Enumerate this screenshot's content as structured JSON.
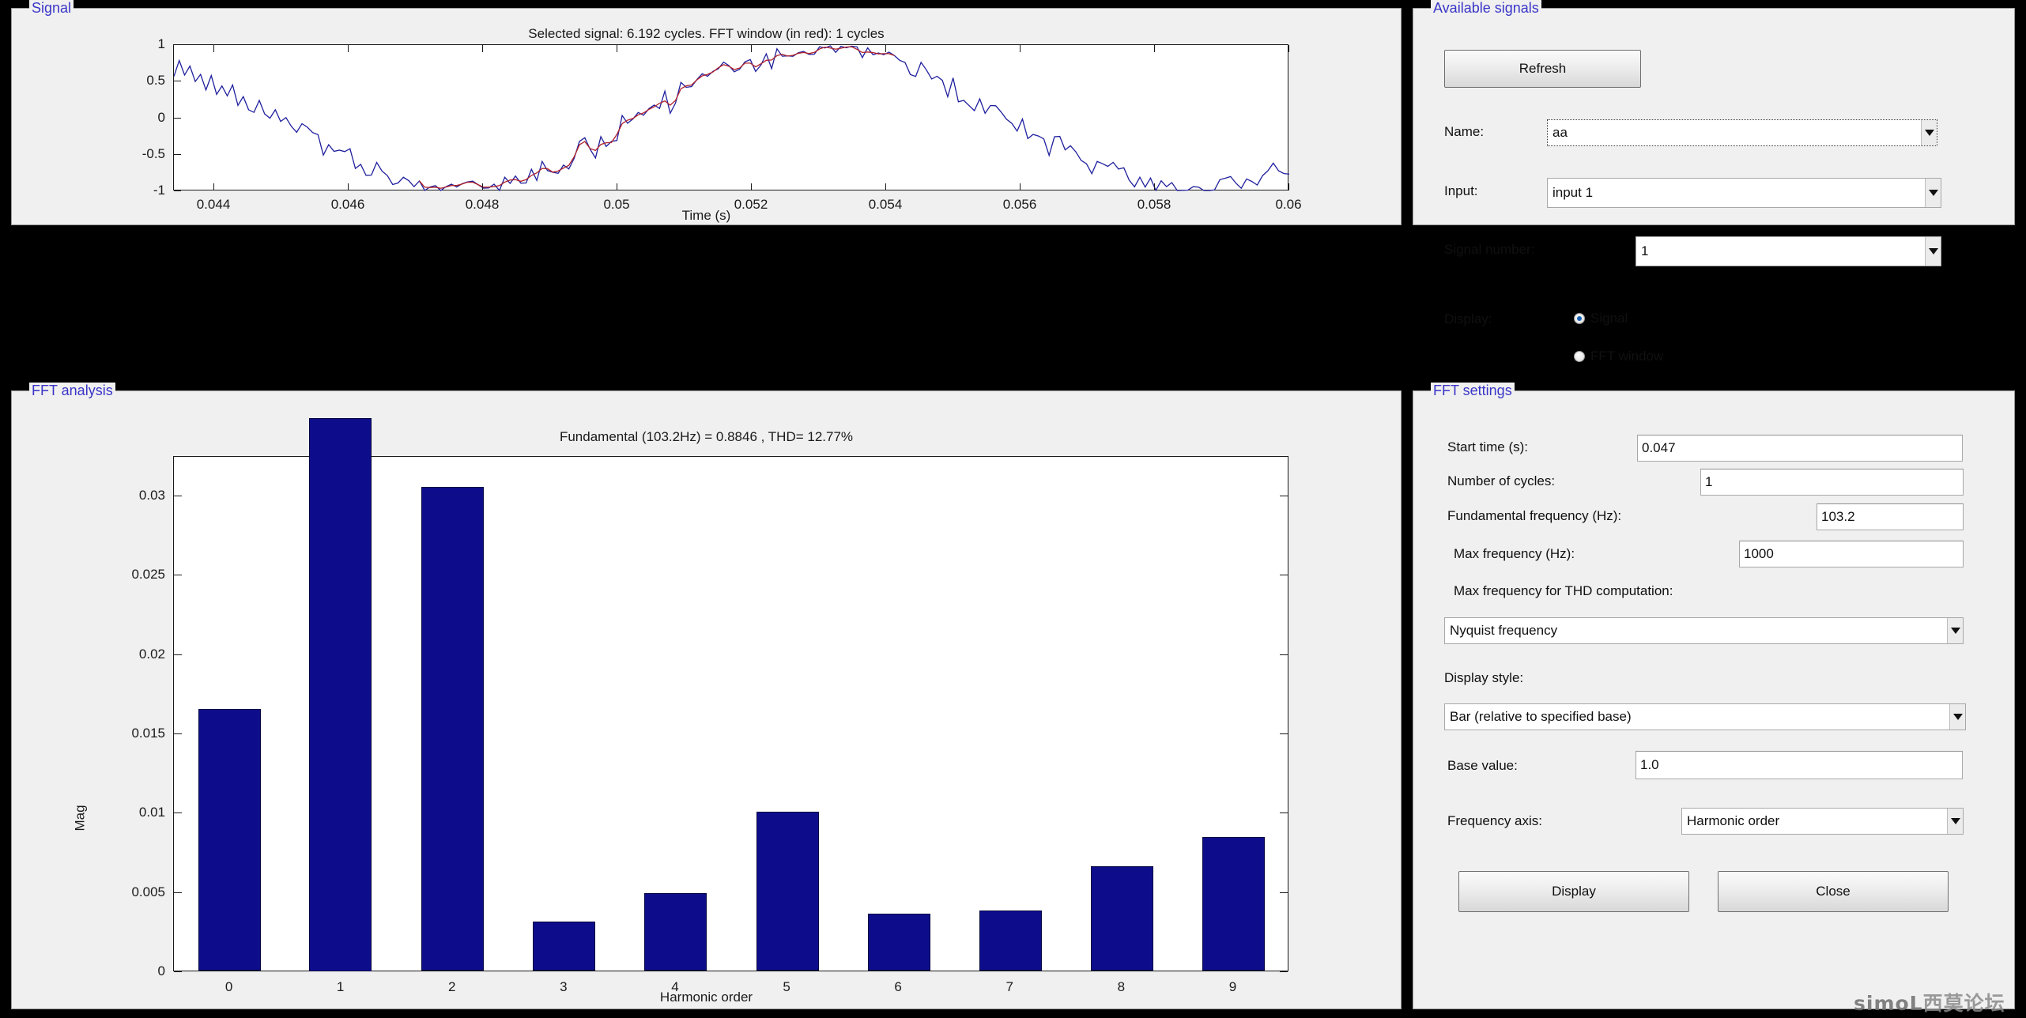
{
  "panels": {
    "signal": {
      "title": "Signal"
    },
    "fft_analysis": {
      "title": "FFT analysis"
    },
    "available_signals": {
      "title": "Available signals"
    },
    "fft_settings": {
      "title": "FFT settings"
    }
  },
  "signal_plot": {
    "title": "Selected signal: 6.192 cycles. FFT window (in red): 1 cycles",
    "xlabel": "Time (s)",
    "yticks": [
      "1",
      "0.5",
      "0",
      "-0.5",
      "-1"
    ],
    "xticks": [
      "0.044",
      "0.046",
      "0.048",
      "0.05",
      "0.052",
      "0.054",
      "0.056",
      "0.058",
      "0.06"
    ]
  },
  "fft_plot": {
    "title": "Fundamental (103.2Hz) = 0.8846 , THD= 12.77%",
    "xlabel": "Harmonic order",
    "ylabel": "Mag"
  },
  "available_signals": {
    "refresh_label": "Refresh",
    "name_label": "Name:",
    "name_value": "aa",
    "input_label": "Input:",
    "input_value": "input 1",
    "signal_number_label": "Signal number:",
    "signal_number_value": "1",
    "display_label": "Display:",
    "radio_signal": "Signal",
    "radio_fft_window": "FFT window",
    "display_selected": "Signal"
  },
  "fft_settings": {
    "start_time_label": "Start time (s):",
    "start_time_value": "0.047",
    "cycles_label": "Number of cycles:",
    "cycles_value": "1",
    "fundamental_label": "Fundamental frequency (Hz):",
    "fundamental_value": "103.2",
    "max_freq_label": "Max frequency (Hz):",
    "max_freq_value": "1000",
    "max_freq_thd_label": "Max frequency for THD computation:",
    "max_freq_thd_value": "Nyquist frequency",
    "display_style_label": "Display style:",
    "display_style_value": "Bar (relative to specified base)",
    "base_value_label": "Base value:",
    "base_value_value": "1.0",
    "freq_axis_label": "Frequency axis:",
    "freq_axis_value": "Harmonic order",
    "display_button": "Display",
    "close_button": "Close"
  },
  "watermark": {
    "text_latin": "simoL",
    "text_cn": "西莫论坛"
  },
  "colors": {
    "panel_title": "#3a36c8",
    "bar_fill": "#0d0d8c",
    "signal_trace": "#1f1f9e",
    "fft_window_trace": "#b0202a",
    "panel_bg": "#f0f0f0",
    "plot_bg": "#ffffff",
    "window_bg": "#000000"
  },
  "chart_data": [
    {
      "type": "line",
      "name": "selected-signal",
      "title": "Selected signal: 6.192 cycles. FFT window (in red): 1 cycles",
      "xlabel": "Time (s)",
      "ylabel": "",
      "xlim": [
        0.0434,
        0.06
      ],
      "ylim": [
        -1,
        1
      ],
      "xticks": [
        0.044,
        0.046,
        0.048,
        0.05,
        0.052,
        0.054,
        0.056,
        0.058,
        0.06
      ],
      "yticks": [
        -1,
        -0.5,
        0,
        0.5,
        1
      ],
      "grid": false,
      "legend": null,
      "series": [
        {
          "name": "signal",
          "color": "#1f1f9e",
          "description": "noisy sinusoid, approx 1 full cycle of a 103.2 Hz carrier with high-frequency ripple, amplitude +/-1"
        },
        {
          "name": "fft-window",
          "color": "#b0202a",
          "description": "red overlay marking the 1-cycle FFT window starting at t = 0.047 s"
        }
      ]
    },
    {
      "type": "bar",
      "name": "fft-magnitude-spectrum",
      "title": "Fundamental (103.2Hz) = 0.8846 , THD= 12.77%",
      "xlabel": "Harmonic order",
      "ylabel": "Mag",
      "categories": [
        "0",
        "1",
        "2",
        "3",
        "4",
        "5",
        "6",
        "7",
        "8",
        "9"
      ],
      "values": [
        0.0165,
        0.0385,
        0.0305,
        0.0031,
        0.0049,
        0.01,
        0.0036,
        0.0038,
        0.0066,
        0.0084
      ],
      "ylim": [
        0,
        0.0325
      ],
      "yticks": [
        0,
        0.005,
        0.01,
        0.015,
        0.02,
        0.025,
        0.03
      ],
      "ytick_labels": [
        "0",
        "0.005",
        "0.01",
        "0.015",
        "0.02",
        "0.025",
        "0.03"
      ],
      "bar_color": "#0d0d8c",
      "grid": false,
      "notes": "Bar at harmonic order 1 (the fundamental, value 0.8846 p.u. scaled) overflows above the plot axes and is clipped by the axes top."
    }
  ]
}
